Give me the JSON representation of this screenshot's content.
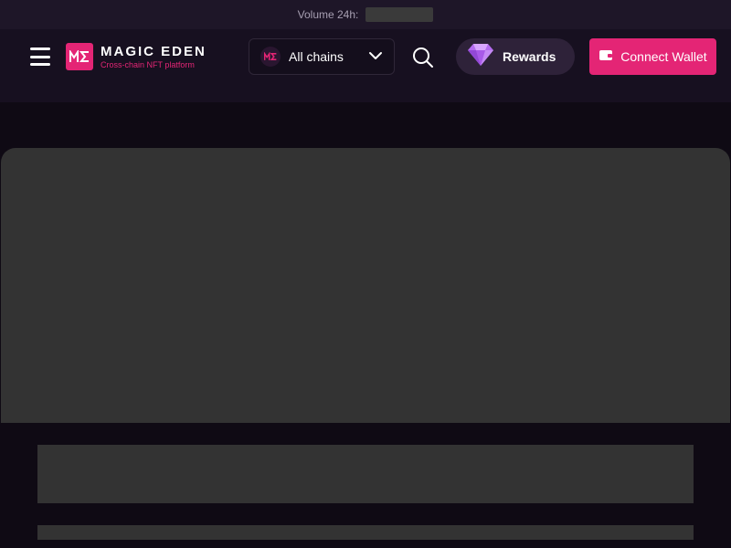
{
  "stats": {
    "volume_label": "Volume 24h:"
  },
  "header": {
    "logo": {
      "title": "MAGIC EDEN",
      "subtitle": "Cross-chain NFT platform",
      "mark_text": "ME"
    },
    "chain_selector": {
      "selected": "All chains"
    },
    "rewards_label": "Rewards",
    "connect_label": "Connect Wallet"
  },
  "colors": {
    "brand": "#e42575",
    "header_bg": "#171020",
    "topbar_bg": "#1e1628",
    "skeleton": "#333333"
  },
  "icons": {
    "menu": "hamburger-icon",
    "chain": "magic-eden-icon",
    "dropdown": "chevron-down-icon",
    "search": "search-icon",
    "rewards": "gem-icon",
    "wallet": "wallet-icon"
  }
}
